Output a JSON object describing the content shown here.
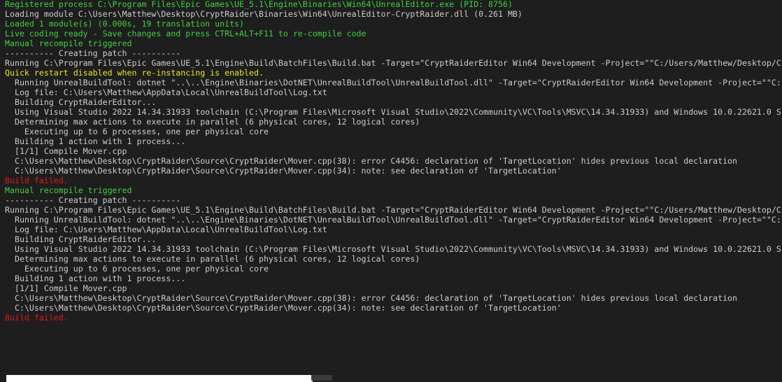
{
  "colors": {
    "default": "#cccccc",
    "green": "#3cd33c",
    "yellow": "#e6e62a",
    "red": "#e0161a",
    "background": "#1e1e1e"
  },
  "console": {
    "lines": [
      {
        "text": "Registered process C:\\Program Files\\Epic Games\\UE_5.1\\Engine\\Binaries\\Win64\\UnrealEditor.exe (PID: 8756)",
        "color": "green"
      },
      {
        "text": "Loading module C:\\Users\\Matthew\\Desktop\\CryptRaider\\Binaries\\Win64\\UnrealEditor-CryptRaider.dll (0.261 MB)",
        "color": "default"
      },
      {
        "text": "Loaded 1 module(s) (0.000s, 19 translation units)",
        "color": "green"
      },
      {
        "text": "Live coding ready - Save changes and press CTRL+ALT+F11 to re-compile code",
        "color": "green"
      },
      {
        "text": "Manual recompile triggered",
        "color": "green"
      },
      {
        "text": "---------- Creating patch ----------",
        "color": "default"
      },
      {
        "text": "Running C:\\Program Files\\Epic Games\\UE_5.1\\Engine\\Build\\BatchFiles\\Build.bat -Target=\"CryptRaiderEditor Win64 Development -Project=\"\"C:/Users/Matthew/Desktop/C",
        "color": "default"
      },
      {
        "text": "Quick restart disabled when re-instancing is enabled.",
        "color": "yellow"
      },
      {
        "text": "  Running UnrealBuildTool: dotnet \"..\\..\\Engine\\Binaries\\DotNET\\UnrealBuildTool\\UnrealBuildTool.dll\" -Target=\"CryptRaiderEditor Win64 Development -Project=\"\"C:",
        "color": "default"
      },
      {
        "text": "  Log file: C:\\Users\\Matthew\\AppData\\Local\\UnrealBuildTool\\Log.txt",
        "color": "default"
      },
      {
        "text": "  Building CryptRaiderEditor...",
        "color": "default"
      },
      {
        "text": "  Using Visual Studio 2022 14.34.31933 toolchain (C:\\Program Files\\Microsoft Visual Studio\\2022\\Community\\VC\\Tools\\MSVC\\14.34.31933) and Windows 10.0.22621.0 S",
        "color": "default"
      },
      {
        "text": "  Determining max actions to execute in parallel (6 physical cores, 12 logical cores)",
        "color": "default"
      },
      {
        "text": "    Executing up to 6 processes, one per physical core",
        "color": "default"
      },
      {
        "text": "  Building 1 action with 1 process...",
        "color": "default"
      },
      {
        "text": "  [1/1] Compile Mover.cpp",
        "color": "default"
      },
      {
        "text": "  C:\\Users\\Matthew\\Desktop\\CryptRaider\\Source\\CryptRaider\\Mover.cpp(38): error C4456: declaration of 'TargetLocation' hides previous local declaration",
        "color": "default"
      },
      {
        "text": "  C:\\Users\\Matthew\\Desktop\\CryptRaider\\Source\\CryptRaider\\Mover.cpp(34): note: see declaration of 'TargetLocation'",
        "color": "default"
      },
      {
        "text": "Build failed.",
        "color": "red"
      },
      {
        "text": "Manual recompile triggered",
        "color": "green"
      },
      {
        "text": "---------- Creating patch ----------",
        "color": "default"
      },
      {
        "text": "Running C:\\Program Files\\Epic Games\\UE_5.1\\Engine\\Build\\BatchFiles\\Build.bat -Target=\"CryptRaiderEditor Win64 Development -Project=\"\"C:/Users/Matthew/Desktop/C",
        "color": "default"
      },
      {
        "text": "  Running UnrealBuildTool: dotnet \"..\\..\\Engine\\Binaries\\DotNET\\UnrealBuildTool\\UnrealBuildTool.dll\" -Target=\"CryptRaiderEditor Win64 Development -Project=\"\"C:",
        "color": "default"
      },
      {
        "text": "  Log file: C:\\Users\\Matthew\\AppData\\Local\\UnrealBuildTool\\Log.txt",
        "color": "default"
      },
      {
        "text": "  Building CryptRaiderEditor...",
        "color": "default"
      },
      {
        "text": "  Using Visual Studio 2022 14.34.31933 toolchain (C:\\Program Files\\Microsoft Visual Studio\\2022\\Community\\VC\\Tools\\MSVC\\14.34.31933) and Windows 10.0.22621.0 S",
        "color": "default"
      },
      {
        "text": "  Determining max actions to execute in parallel (6 physical cores, 12 logical cores)",
        "color": "default"
      },
      {
        "text": "    Executing up to 6 processes, one per physical core",
        "color": "default"
      },
      {
        "text": "  Building 1 action with 1 process...",
        "color": "default"
      },
      {
        "text": "  [1/1] Compile Mover.cpp",
        "color": "default"
      },
      {
        "text": "  C:\\Users\\Matthew\\Desktop\\CryptRaider\\Source\\CryptRaider\\Mover.cpp(38): error C4456: declaration of 'TargetLocation' hides previous local declaration",
        "color": "default"
      },
      {
        "text": "  C:\\Users\\Matthew\\Desktop\\CryptRaider\\Source\\CryptRaider\\Mover.cpp(34): note: see declaration of 'TargetLocation'",
        "color": "default"
      },
      {
        "text": "Build failed.",
        "color": "red"
      }
    ]
  }
}
